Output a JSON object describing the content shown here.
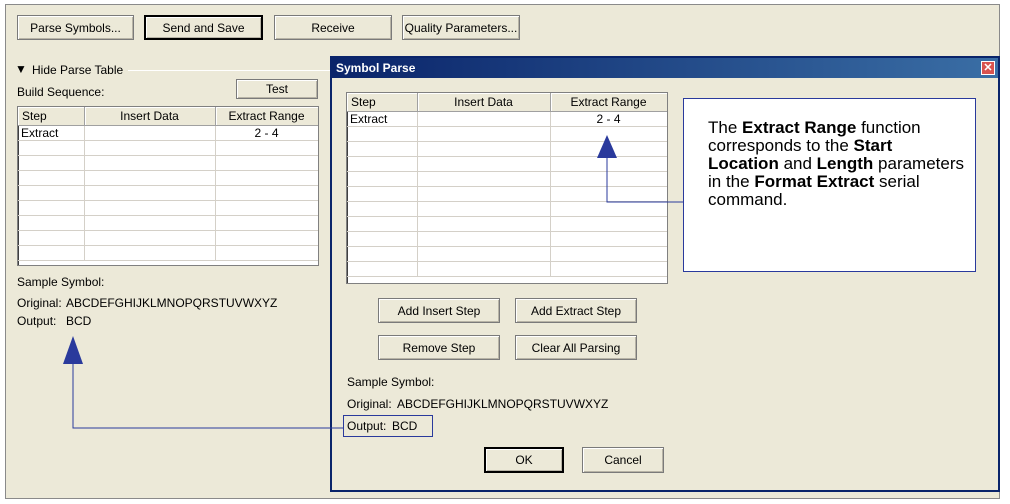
{
  "toolbar": {
    "parse_symbols": "Parse Symbols...",
    "send_and_save": "Send and Save",
    "receive": "Receive",
    "quality_parameters": "Quality Parameters..."
  },
  "left_panel": {
    "hide_parse_table": "Hide Parse Table",
    "build_sequence": "Build Sequence:",
    "test_button": "Test",
    "columns": [
      "Step",
      "Insert Data",
      "Extract Range"
    ],
    "rows": [
      [
        "Extract",
        "",
        "2 - 4"
      ]
    ],
    "sample_symbol_label": "Sample Symbol:",
    "original_label": "Original:",
    "original_value": "ABCDEFGHIJKLMNOPQRSTUVWXYZ",
    "output_label": "Output:",
    "output_value": "BCD"
  },
  "dialog": {
    "title": "Symbol Parse",
    "columns": [
      "Step",
      "Insert Data",
      "Extract Range"
    ],
    "rows": [
      [
        "Extract",
        "",
        "2 - 4"
      ]
    ],
    "add_insert_step": "Add Insert Step",
    "add_extract_step": "Add Extract Step",
    "remove_step": "Remove Step",
    "clear_all_parsing": "Clear All Parsing",
    "sample_symbol_label": "Sample Symbol:",
    "original_label": "Original:",
    "original_value": "ABCDEFGHIJKLMNOPQRSTUVWXYZ",
    "output_label": "Output:",
    "output_value": "BCD",
    "ok": "OK",
    "cancel": "Cancel"
  },
  "callout": {
    "t1": "The ",
    "b1": "Extract Range",
    "t2": " function corresponds to the ",
    "b2": "Start Location",
    "t3": " and ",
    "b3": "Length",
    "t4": " parameters in the ",
    "b4": "Format Extract",
    "t5": " serial command."
  },
  "colors": {
    "window_bg": "#ece9d8",
    "title_bar": "#0a246a",
    "annotation": "#2a3a9c"
  }
}
